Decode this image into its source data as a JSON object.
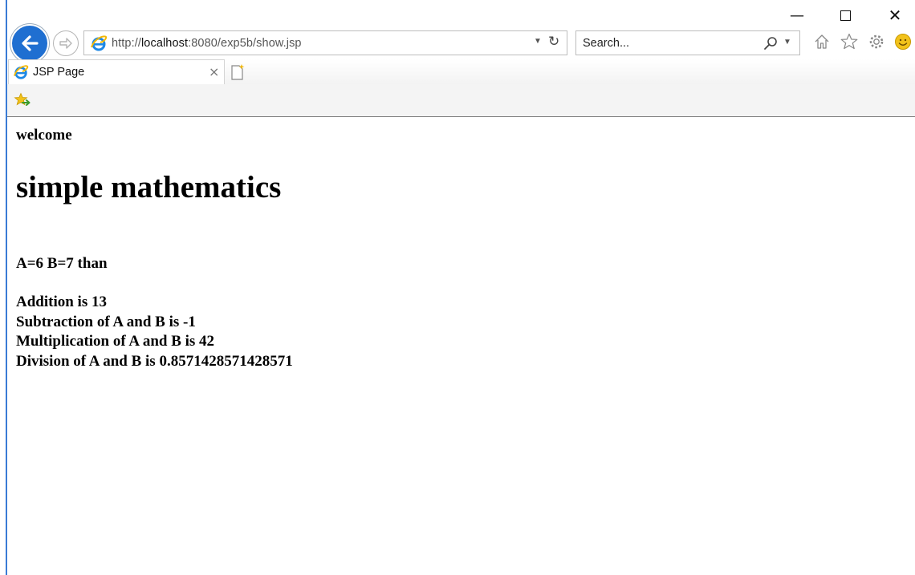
{
  "window": {
    "minimize_glyph": "—",
    "close_glyph": "✕"
  },
  "toolbar": {
    "address": {
      "scheme": "http://",
      "host": "localhost",
      "rest": ":8080/exp5b/show.jsp"
    },
    "search": {
      "placeholder": "Search..."
    },
    "icons": [
      "back-icon",
      "forward-icon",
      "ie-icon",
      "dropdown-icon",
      "refresh-icon",
      "search-icon",
      "home-icon",
      "favorites-star-icon",
      "gear-icon",
      "smiley-icon"
    ]
  },
  "tabs": [
    {
      "label": "JSP Page",
      "close_glyph": "×"
    }
  ],
  "page": {
    "welcome": "welcome",
    "title": "simple mathematics",
    "values_line": "A=6 B=7 than",
    "results": [
      "Addition is 13",
      "Subtraction of A and B is -1",
      "Multiplication of A and B is 42",
      "Division of A and B is 0.8571428571428571"
    ]
  },
  "colors": {
    "back_button": "#1f6fd1",
    "ie_blue": "#1e88e5",
    "favorites_yellow": "#f2c21b"
  }
}
